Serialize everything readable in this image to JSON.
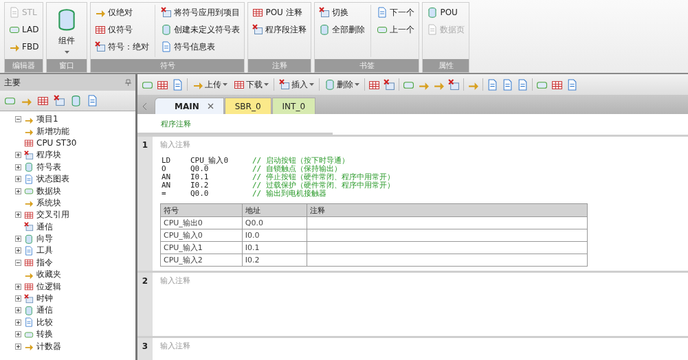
{
  "ribbon": {
    "groups": [
      {
        "label": "编辑器",
        "columns": [
          [
            {
              "label": "STL",
              "disabled": true
            },
            {
              "label": "LAD",
              "disabled": false
            },
            {
              "label": "FBD",
              "disabled": false
            }
          ]
        ]
      },
      {
        "label": "窗口",
        "big": {
          "label": "组件"
        }
      },
      {
        "label": "符号",
        "columns": [
          [
            {
              "label": "仅绝对",
              "disabled": false
            },
            {
              "label": "仅符号",
              "disabled": false
            },
            {
              "label": "符号：绝对",
              "disabled": false
            }
          ],
          [
            {
              "label": "将符号应用到项目",
              "disabled": false
            },
            {
              "label": "创建未定义符号表",
              "disabled": false
            },
            {
              "label": "符号信息表",
              "disabled": false
            }
          ]
        ]
      },
      {
        "label": "注释",
        "columns": [
          [
            {
              "label": "POU 注释",
              "disabled": false
            },
            {
              "label": "程序段注释",
              "disabled": false
            }
          ]
        ]
      },
      {
        "label": "书签",
        "columns": [
          [
            {
              "label": "切换",
              "disabled": false
            },
            {
              "label": "全部删除",
              "disabled": false
            }
          ],
          [
            {
              "label": "下一个",
              "disabled": false
            },
            {
              "label": "上一个",
              "disabled": false
            }
          ]
        ]
      },
      {
        "label": "属性",
        "columns": [
          [
            {
              "label": "POU",
              "disabled": false
            },
            {
              "label": "数据页",
              "disabled": true
            }
          ]
        ]
      }
    ]
  },
  "sidebar": {
    "title": "主要",
    "tree": [
      {
        "label": "项目1",
        "expanded": true,
        "children": [
          {
            "label": "新增功能"
          },
          {
            "label": "CPU ST30"
          },
          {
            "label": "程序块",
            "expanded": false
          },
          {
            "label": "符号表",
            "expanded": false
          },
          {
            "label": "状态图表",
            "expanded": false
          },
          {
            "label": "数据块",
            "expanded": false
          },
          {
            "label": "系统块"
          },
          {
            "label": "交叉引用",
            "expanded": false
          },
          {
            "label": "通信"
          },
          {
            "label": "向导",
            "expanded": false
          },
          {
            "label": "工具",
            "expanded": false
          }
        ]
      },
      {
        "label": "指令",
        "expanded": true,
        "children": [
          {
            "label": "收藏夹"
          },
          {
            "label": "位逻辑",
            "expanded": false
          },
          {
            "label": "时钟",
            "expanded": false
          },
          {
            "label": "通信",
            "expanded": false
          },
          {
            "label": "比较",
            "expanded": false
          },
          {
            "label": "转换",
            "expanded": false
          },
          {
            "label": "计数器",
            "expanded": false
          }
        ]
      }
    ]
  },
  "toolbar": {
    "buttons": [
      {
        "label": "上传"
      },
      {
        "label": "下载"
      },
      {
        "label": "插入"
      },
      {
        "label": "删除"
      }
    ]
  },
  "tabs": [
    {
      "label": "MAIN",
      "selected": true,
      "color": "#eef3fb"
    },
    {
      "label": "SBR_0",
      "selected": false,
      "color": "#fbe98a"
    },
    {
      "label": "INT_0",
      "selected": false,
      "color": "#d7eab0"
    }
  ],
  "editor": {
    "program_comment": "程序注释",
    "networks": [
      {
        "number": "1",
        "comment": "输入注释",
        "code": [
          {
            "instruction": "LD",
            "operand": "CPU_输入0",
            "comment": "// 启动按钮（按下时导通）"
          },
          {
            "instruction": "O",
            "operand": "Q0.0",
            "comment": "// 自锁触点（保持输出）"
          },
          {
            "instruction": "AN",
            "operand": "I0.1",
            "comment": "// 停止按钮（硬件常闭、程序中用常开）"
          },
          {
            "instruction": "AN",
            "operand": "I0.2",
            "comment": "// 过载保护（硬件常闭、程序中用常开）"
          },
          {
            "instruction": "=",
            "operand": "Q0.0",
            "comment": "// 输出到电机接触器"
          }
        ],
        "symbol_table": {
          "columns": [
            "符号",
            "地址",
            "注释"
          ],
          "rows": [
            [
              "CPU_输出0",
              "Q0.0",
              ""
            ],
            [
              "CPU_输入0",
              "I0.0",
              ""
            ],
            [
              "CPU_输入1",
              "I0.1",
              ""
            ],
            [
              "CPU_输入2",
              "I0.2",
              ""
            ]
          ]
        }
      },
      {
        "number": "2",
        "comment": "输入注释"
      },
      {
        "number": "3",
        "comment": "输入注释"
      }
    ]
  }
}
